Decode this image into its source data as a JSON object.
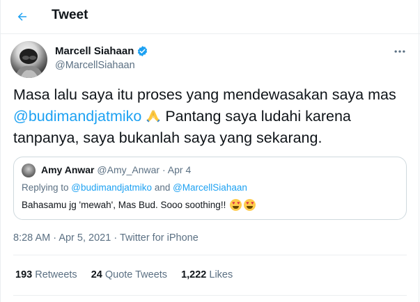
{
  "header": {
    "title": "Tweet"
  },
  "author": {
    "name": "Marcell Siahaan",
    "handle": "@MarcellSiahaan",
    "verified": true
  },
  "tweet": {
    "text_parts": [
      "Masa lalu saya itu proses yang mendewasakan saya mas ",
      "@budimandjatmiko",
      " Pantang saya ludahi karena tanpanya, saya bukanlah saya yang sekarang."
    ],
    "emoji": "folded-hands"
  },
  "quote": {
    "name": "Amy Anwar",
    "handle": "@Amy_Anwar",
    "separator": "·",
    "date": "Apr 4",
    "replying_prefix": "Replying to ",
    "reply_mention_1": "@budimandjatmiko",
    "reply_and": " and ",
    "reply_mention_2": "@MarcellSiahaan",
    "text": "Bahasamu jg 'mewah', Mas Bud. Sooo soothing!!",
    "emojis": [
      "heart-eyes",
      "heart-eyes"
    ]
  },
  "meta": {
    "time": "8:28 AM",
    "dot": "·",
    "date": "Apr 5, 2021",
    "source": "Twitter for iPhone"
  },
  "stats": {
    "retweets_count": "193",
    "retweets_label": "Retweets",
    "quote_count": "24",
    "quote_label": "Quote Tweets",
    "likes_count": "1,222",
    "likes_label": "Likes"
  },
  "colors": {
    "accent": "#1da1f2",
    "secondary_text": "#5b7083",
    "border": "#ebeef0"
  }
}
